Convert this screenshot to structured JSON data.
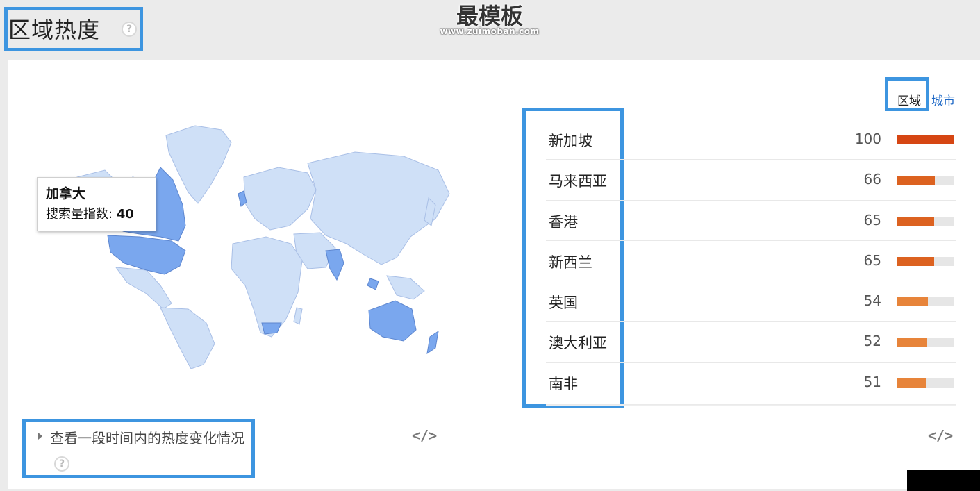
{
  "header": {
    "title": "区域热度",
    "help_glyph": "?"
  },
  "watermark": {
    "main": "最模板",
    "sub": "www.zuimoban.com"
  },
  "toggle": {
    "region": "区域",
    "city": "城市"
  },
  "tooltip": {
    "country": "加拿大",
    "metric_label": "搜索量指数:",
    "metric_value": "40"
  },
  "rankings": [
    {
      "name": "新加坡",
      "value": "100",
      "level": 100,
      "color": "#d64613"
    },
    {
      "name": "马来西亚",
      "value": "66",
      "level": 66,
      "color": "#dc6220"
    },
    {
      "name": "香港",
      "value": "65",
      "level": 65,
      "color": "#dc6220"
    },
    {
      "name": "新西兰",
      "value": "65",
      "level": 65,
      "color": "#dc6220"
    },
    {
      "name": "英国",
      "value": "54",
      "level": 54,
      "color": "#e7843a"
    },
    {
      "name": "澳大利亚",
      "value": "52",
      "level": 52,
      "color": "#e7843a"
    },
    {
      "name": "南非",
      "value": "51",
      "level": 51,
      "color": "#e7843a"
    }
  ],
  "change_link": {
    "text": "查看一段时间内的热度变化情况",
    "help_glyph": "?"
  },
  "embed": {
    "glyph": "</>"
  },
  "colors": {
    "highlight": "#3d95e0",
    "map_base": "#cfe0f7",
    "map_strong": "#7aa7ee",
    "map_border": "#a9bfe6",
    "link": "#1a66c5"
  }
}
